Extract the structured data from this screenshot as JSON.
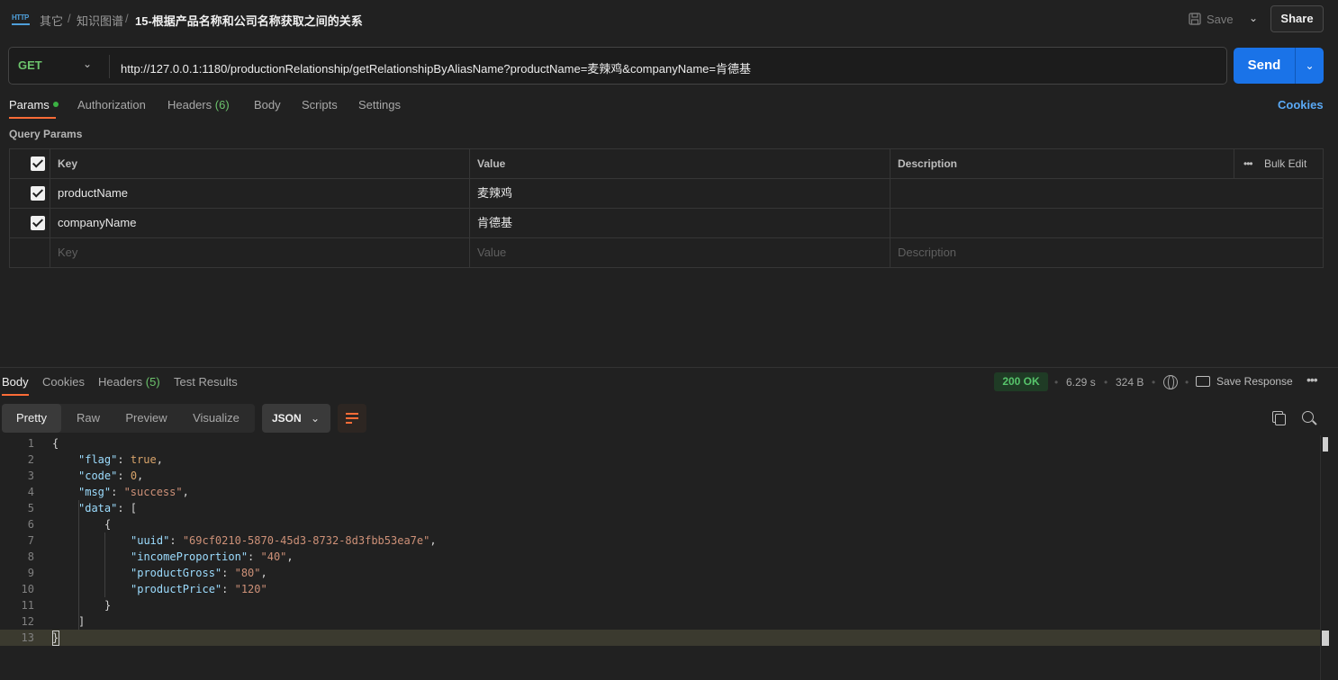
{
  "header": {
    "http_icon": "HTTP",
    "breadcrumb": [
      "其它",
      "知识图谱"
    ],
    "request_name": "15-根据产品名称和公司名称获取之间的关系",
    "save_label": "Save",
    "share_label": "Share"
  },
  "request": {
    "method": "GET",
    "url": "http://127.0.0.1:1180/productionRelationship/getRelationshipByAliasName?productName=麦辣鸡&companyName=肯德基",
    "send_label": "Send"
  },
  "request_tabs": {
    "params": "Params",
    "authorization": "Authorization",
    "headers": "Headers",
    "headers_count": "(6)",
    "body": "Body",
    "scripts": "Scripts",
    "settings": "Settings",
    "cookies": "Cookies"
  },
  "query_params": {
    "label": "Query Params",
    "columns": {
      "key": "Key",
      "value": "Value",
      "description": "Description"
    },
    "bulk_edit": "Bulk Edit",
    "rows": [
      {
        "key": "productName",
        "value": "麦辣鸡"
      },
      {
        "key": "companyName",
        "value": "肯德基"
      }
    ],
    "placeholders": {
      "key": "Key",
      "value": "Value",
      "description": "Description"
    }
  },
  "response": {
    "tabs": {
      "body": "Body",
      "cookies": "Cookies",
      "headers": "Headers",
      "headers_count": "(5)",
      "test_results": "Test Results"
    },
    "status": "200 OK",
    "time": "6.29 s",
    "size": "324 B",
    "save_response": "Save Response",
    "views": [
      "Pretty",
      "Raw",
      "Preview",
      "Visualize"
    ],
    "format": "JSON",
    "body_lines": [
      "{",
      "\"flag\": true,",
      "\"code\": 0,",
      "\"msg\": \"success\",",
      "\"data\": [",
      "{",
      "\"uuid\": \"69cf0210-5870-45d3-8732-8d3fbb53ea7e\",",
      "\"incomeProportion\": \"40\",",
      "\"productGross\": \"80\",",
      "\"productPrice\": \"120\"",
      "}",
      "]",
      "}"
    ]
  },
  "colors": {
    "accent": "#ff6c37",
    "send": "#1a73e8",
    "status_ok": "#57c46b",
    "method_get": "#6cc36c"
  }
}
